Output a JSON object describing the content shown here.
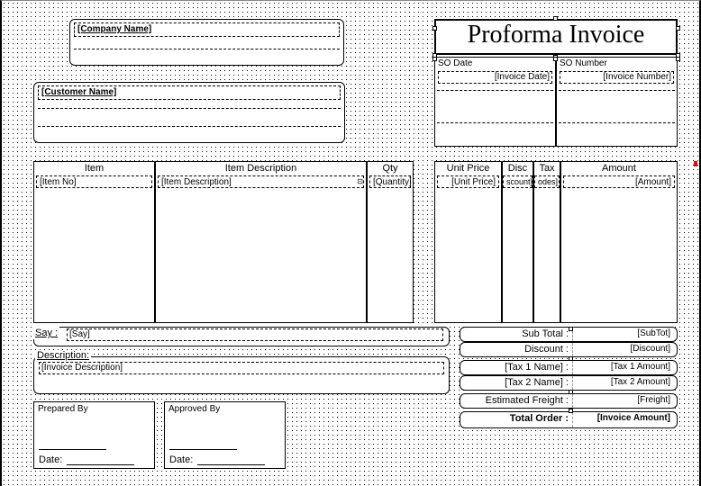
{
  "header": {
    "title": "Proforma Invoice",
    "company_field": "[Company Name]",
    "customer_field": "[Customer Name]",
    "so_date_label": "SO Date",
    "so_date_field": "[Invoice Date]",
    "so_number_label": "SO Number",
    "so_number_field": "[Invoice Number]"
  },
  "columns": {
    "item": {
      "header": "Item",
      "field": "[Item No]"
    },
    "desc": {
      "header": "Item Description",
      "field": "[Item Description]"
    },
    "qty": {
      "header": "Qty",
      "field": "[Quantity]"
    },
    "unit": {
      "header": "Unit Price",
      "field": "[Unit Price]"
    },
    "disc": {
      "header": "Disc",
      "field": "scount]"
    },
    "tax": {
      "header": "Tax",
      "field": "odes]"
    },
    "amount": {
      "header": "Amount",
      "field": "[Amount]"
    }
  },
  "say": {
    "label": "Say :",
    "field": "[Say]"
  },
  "description": {
    "label": "Description:",
    "field": "[Invoice Description]"
  },
  "signatures": {
    "prepared": {
      "label": "Prepared By",
      "date": "Date:"
    },
    "approved": {
      "label": "Approved By",
      "date": "Date:"
    }
  },
  "totals": {
    "subtotal": {
      "label": "Sub Total :",
      "field": "[SubTot]"
    },
    "discount": {
      "label": "Discount :",
      "field": "[Discount]"
    },
    "tax1": {
      "label": "[Tax 1 Name] :",
      "field": "[Tax 1 Amount]"
    },
    "tax2": {
      "label": "[Tax 2 Name] :",
      "field": "[Tax 2 Amount]"
    },
    "freight": {
      "label": "Estimated Freight :",
      "field": "[Freight]"
    },
    "total": {
      "label": "Total Order :",
      "field": "[Invoice Amount]"
    }
  }
}
